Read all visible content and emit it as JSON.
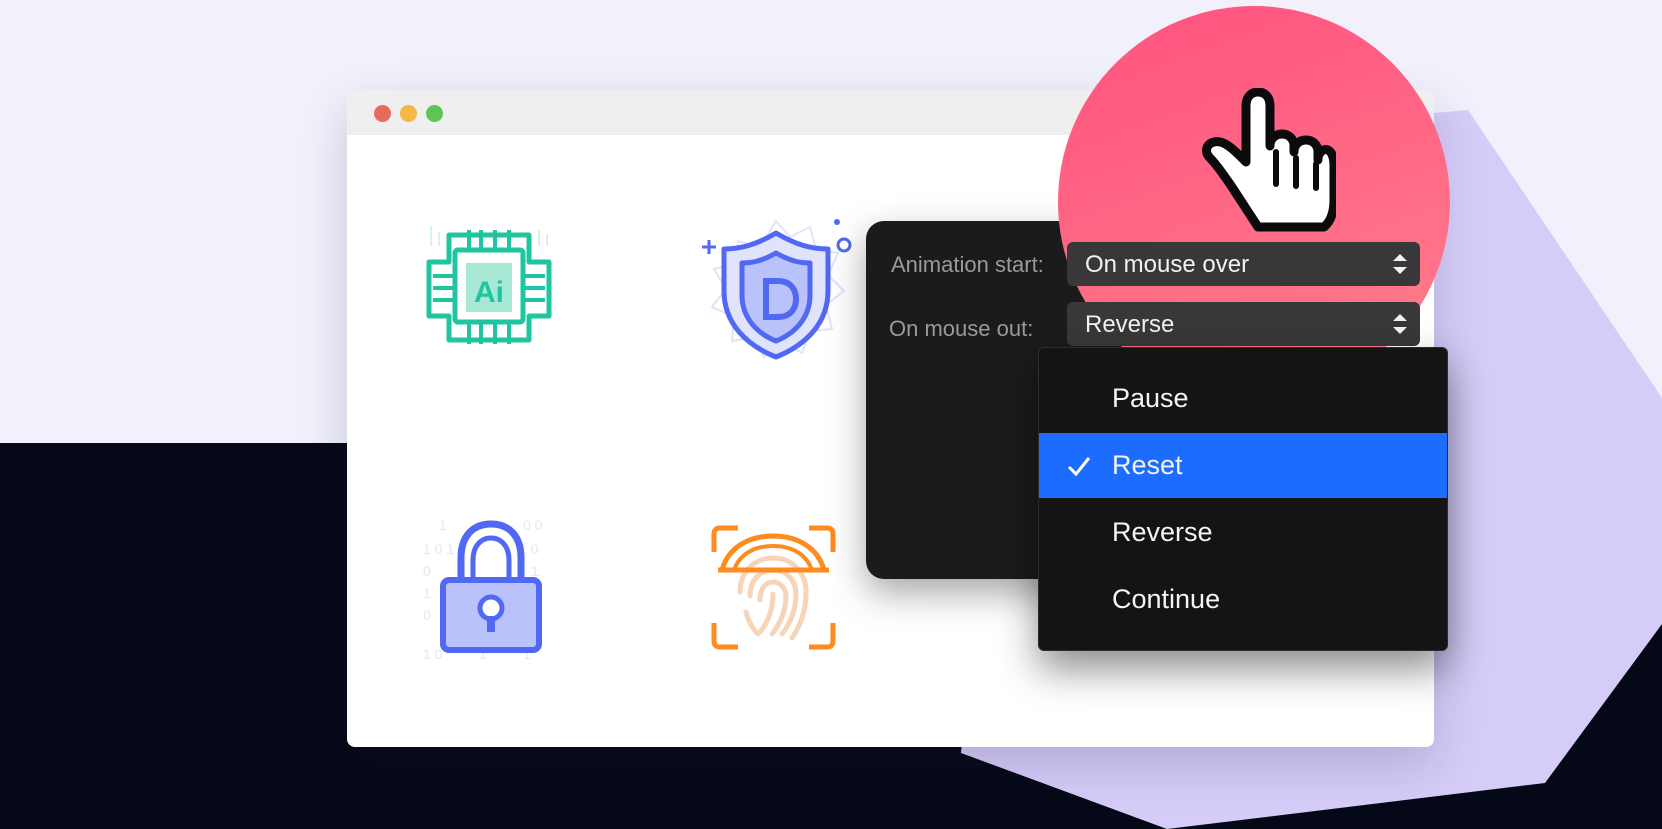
{
  "colors": {
    "accent": "#1c6cff",
    "cursor_bubble": "#ff5b81",
    "panel": "#1b1b1c",
    "ai_chip": "#1fc5a0",
    "shield": "#5168f2",
    "lock": "#5168f2",
    "fingerprint": "#ff8a1d"
  },
  "window": {
    "traffic_lights": [
      "close",
      "minimize",
      "maximize"
    ]
  },
  "icons": [
    "ai-chip-icon",
    "shield-d-icon",
    "padlock-icon",
    "fingerprint-scan-icon"
  ],
  "settings": {
    "animation_start": {
      "label": "Animation start:",
      "value": "On mouse over"
    },
    "mouse_out": {
      "label": "On mouse out:",
      "value": "Reverse"
    }
  },
  "dropdown": {
    "options": [
      "Pause",
      "Reset",
      "Reverse",
      "Continue"
    ],
    "selected": "Reset"
  },
  "cursor": {
    "icon": "hand-pointer-icon"
  }
}
